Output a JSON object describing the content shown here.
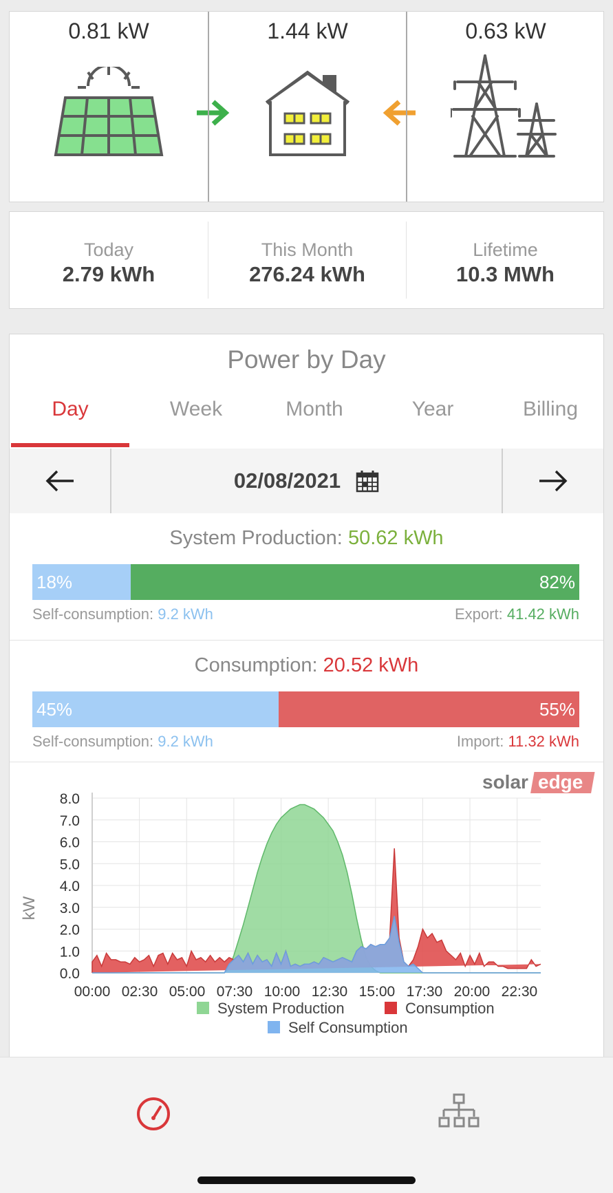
{
  "flow": {
    "solar_value": "0.81 kW",
    "house_value": "1.44 kW",
    "grid_value": "0.63 kW",
    "colors": {
      "solar_green": "#86e08f",
      "arrow_green": "#3db04b",
      "arrow_orange": "#f0a030",
      "icon_gray": "#5a5a5a",
      "window_yellow": "#f2ef3b"
    }
  },
  "energy": {
    "today_label": "Today",
    "today_value": "2.79 kWh",
    "month_label": "This Month",
    "month_value": "276.24 kWh",
    "lifetime_label": "Lifetime",
    "lifetime_value": "10.3 MWh"
  },
  "power": {
    "title": "Power by Day",
    "tabs": [
      "Day",
      "Week",
      "Month",
      "Year",
      "Billing"
    ],
    "active_tab": "Day",
    "date": "02/08/2021",
    "production": {
      "label": "System Production:",
      "value": "50.62 kWh",
      "self_pct_label": "18%",
      "export_pct_label": "82%",
      "self_fraction": 0.18,
      "self_label": "Self-consumption:",
      "self_value": "9.2 kWh",
      "export_label": "Export:",
      "export_value": "41.42 kWh"
    },
    "consumption": {
      "label": "Consumption:",
      "value": "20.52 kWh",
      "self_pct_label": "45%",
      "import_pct_label": "55%",
      "self_fraction": 0.45,
      "self_label": "Self-consumption:",
      "self_value": "9.2 kWh",
      "import_label": "Import:",
      "import_value": "11.32 kWh"
    },
    "brand": {
      "left": "solar",
      "right": "edge"
    }
  },
  "chart_data": {
    "type": "area",
    "ylabel": "kW",
    "ylim": [
      0,
      8
    ],
    "yticks": [
      "8.0",
      "7.0",
      "6.0",
      "5.0",
      "4.0",
      "3.0",
      "2.0",
      "1.0",
      "0.0"
    ],
    "xticks": [
      "00:00",
      "02:30",
      "05:00",
      "07:30",
      "10:00",
      "12:30",
      "15:00",
      "17:30",
      "20:00",
      "22:30"
    ],
    "grid": true,
    "legend_placement": "bottom",
    "x": [
      0,
      0.25,
      0.5,
      0.75,
      1,
      1.25,
      1.5,
      1.75,
      2,
      2.25,
      2.5,
      2.75,
      3,
      3.25,
      3.5,
      3.75,
      4,
      4.25,
      4.5,
      4.75,
      5,
      5.25,
      5.5,
      5.75,
      6,
      6.25,
      6.5,
      6.75,
      7,
      7.25,
      7.5,
      7.75,
      8,
      8.25,
      8.5,
      8.75,
      9,
      9.25,
      9.5,
      9.75,
      10,
      10.25,
      10.5,
      10.75,
      11,
      11.25,
      11.5,
      11.75,
      12,
      12.25,
      12.5,
      12.75,
      13,
      13.25,
      13.5,
      13.75,
      14,
      14.25,
      14.5,
      14.75,
      15,
      15.25,
      15.5,
      15.75,
      16,
      16.25,
      16.5,
      16.75,
      17,
      17.25,
      17.5,
      17.75,
      18,
      18.25,
      18.5,
      18.75,
      19,
      19.25,
      19.5,
      19.75,
      20,
      20.25,
      20.5,
      20.75,
      21,
      21.25,
      21.5,
      21.75,
      22,
      22.25,
      22.5,
      22.75,
      23,
      23.25,
      23.5,
      23.75
    ],
    "series": [
      {
        "name": "System Production",
        "color": "#8fd694",
        "values": [
          0,
          0,
          0,
          0,
          0,
          0,
          0,
          0,
          0,
          0,
          0,
          0,
          0,
          0,
          0,
          0,
          0,
          0,
          0,
          0,
          0,
          0,
          0,
          0,
          0,
          0,
          0,
          0,
          0,
          0.2,
          0.8,
          1.5,
          2.2,
          3.0,
          3.8,
          4.6,
          5.3,
          5.9,
          6.4,
          6.8,
          7.1,
          7.3,
          7.5,
          7.6,
          7.7,
          7.7,
          7.6,
          7.5,
          7.3,
          7.1,
          6.8,
          6.5,
          6.0,
          5.4,
          4.6,
          3.6,
          2.5,
          1.5,
          0.7,
          0.3,
          0.1,
          0,
          0,
          0,
          0,
          0,
          0,
          0,
          0,
          0,
          0,
          0,
          0,
          0,
          0,
          0,
          0,
          0,
          0,
          0,
          0,
          0,
          0,
          0,
          0,
          0,
          0,
          0,
          0,
          0,
          0,
          0,
          0,
          0,
          0,
          0,
          0,
          0
        ]
      },
      {
        "name": "Consumption",
        "color": "#e05050",
        "values": [
          0.5,
          0.8,
          0.3,
          0.9,
          0.6,
          0.6,
          0.5,
          0.5,
          0.4,
          0.7,
          0.5,
          0.6,
          0.8,
          0.3,
          0.8,
          0.9,
          0.4,
          0.9,
          0.6,
          0.7,
          0.3,
          1.0,
          0.6,
          0.7,
          0.5,
          0.8,
          0.5,
          0.7,
          0.5,
          0.7,
          0.6,
          0.8,
          0.5,
          0.9,
          0.4,
          0.8,
          0.5,
          0.6,
          0.3,
          0.9,
          0.4,
          1.0,
          0.3,
          0.4,
          0.3,
          0.4,
          0.4,
          0.5,
          0.4,
          0.7,
          0.6,
          0.5,
          0.6,
          0.7,
          0.6,
          0.5,
          1.0,
          1.2,
          1.1,
          1.3,
          1.2,
          1.3,
          1.3,
          1.6,
          5.7,
          1.6,
          0.5,
          0.3,
          0.6,
          1.2,
          2.0,
          1.6,
          1.8,
          1.4,
          1.5,
          1.0,
          0.8,
          0.6,
          0.9,
          0.3,
          0.8,
          0.4,
          0.9,
          0.3,
          0.5,
          0.5,
          0.3,
          0.3,
          0.2,
          0.2,
          0.2,
          0.2,
          0.2,
          0.6,
          0.3,
          0.4,
          0.5,
          0.7
        ]
      },
      {
        "name": "Self Consumption",
        "color": "#7fb4ef",
        "values": [
          0,
          0,
          0,
          0,
          0,
          0,
          0,
          0,
          0,
          0,
          0,
          0,
          0,
          0,
          0,
          0,
          0,
          0,
          0,
          0,
          0,
          0,
          0,
          0,
          0,
          0,
          0,
          0,
          0,
          0.4,
          0.6,
          0.8,
          0.5,
          0.9,
          0.4,
          0.8,
          0.5,
          0.6,
          0.3,
          0.9,
          0.4,
          1.0,
          0.3,
          0.4,
          0.3,
          0.4,
          0.4,
          0.5,
          0.4,
          0.7,
          0.6,
          0.5,
          0.6,
          0.7,
          0.6,
          0.5,
          1.0,
          1.2,
          1.1,
          1.3,
          1.2,
          1.3,
          1.3,
          1.6,
          2.6,
          1.4,
          0.5,
          0.3,
          0.4,
          0.2,
          0,
          0,
          0,
          0,
          0,
          0,
          0,
          0,
          0,
          0,
          0,
          0,
          0,
          0,
          0,
          0,
          0,
          0,
          0,
          0,
          0,
          0,
          0,
          0,
          0,
          0,
          0,
          0
        ]
      }
    ]
  }
}
